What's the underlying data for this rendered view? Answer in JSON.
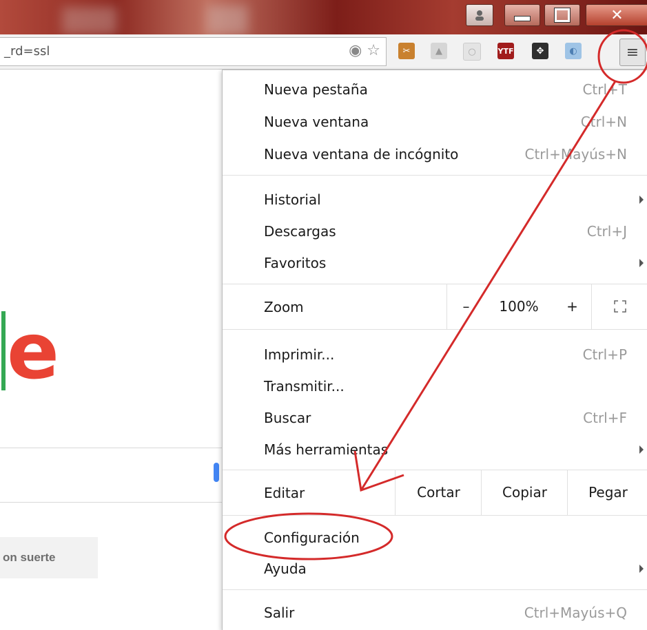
{
  "omnibox": {
    "url_fragment": "_rd=ssl"
  },
  "page": {
    "lucky_button_fragment": "on suerte"
  },
  "menu": {
    "group1": [
      {
        "label": "Nueva pestaña",
        "shortcut": "Ctrl+T"
      },
      {
        "label": "Nueva ventana",
        "shortcut": "Ctrl+N"
      },
      {
        "label": "Nueva ventana de incógnito",
        "shortcut": "Ctrl+Mayús+N"
      }
    ],
    "group2": [
      {
        "label": "Historial"
      },
      {
        "label": "Descargas",
        "shortcut": "Ctrl+J"
      },
      {
        "label": "Favoritos"
      }
    ],
    "zoom": {
      "label": "Zoom",
      "minus": "–",
      "value": "100%",
      "plus": "+"
    },
    "group3": [
      {
        "label": "Imprimir...",
        "shortcut": "Ctrl+P"
      },
      {
        "label": "Transmitir..."
      },
      {
        "label": "Buscar",
        "shortcut": "Ctrl+F"
      },
      {
        "label": "Más herramientas"
      }
    ],
    "edit": {
      "label": "Editar",
      "cut": "Cortar",
      "copy": "Copiar",
      "paste": "Pegar"
    },
    "group4": [
      {
        "label": "Configuración"
      },
      {
        "label": "Ayuda"
      }
    ],
    "exit": {
      "label": "Salir",
      "shortcut": "Ctrl+Mayús+Q"
    }
  },
  "annotation_color": "#d42a2a",
  "icons": {
    "profile": "user-icon",
    "minimize": "minimize-icon",
    "maximize": "maximize-icon",
    "close": "close-icon",
    "location": "location-icon",
    "star": "star-icon",
    "menu": "hamburger-menu-icon",
    "fullscreen": "fullscreen-icon",
    "submenu": "submenu-arrow-icon"
  },
  "extensions": [
    "scissors-extension-icon",
    "extension-icon",
    "extension-icon",
    "ytf-extension-icon",
    "extension-icon",
    "extension-icon"
  ]
}
